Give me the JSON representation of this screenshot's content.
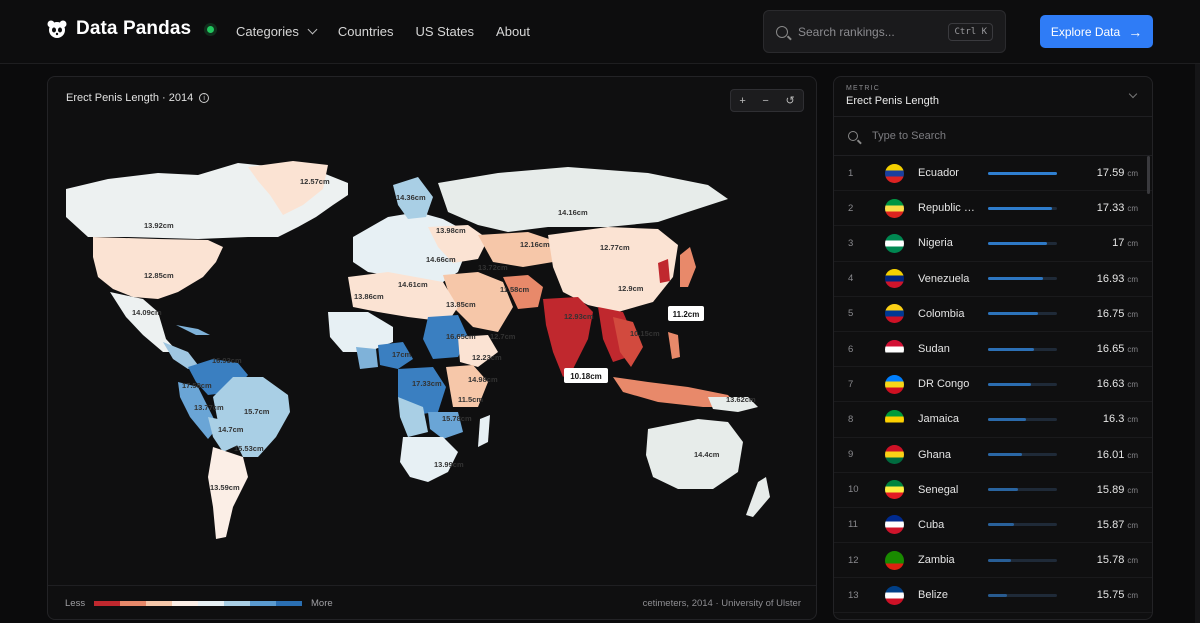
{
  "header": {
    "logo_text": "Data Pandas",
    "nav": [
      {
        "label": "Categories",
        "has_dropdown": true
      },
      {
        "label": "Countries"
      },
      {
        "label": "US States"
      },
      {
        "label": "About"
      }
    ],
    "search_placeholder": "Search rankings...",
    "search_shortcut": "Ctrl K",
    "cta_label": "Explore Data",
    "accent": "#2f7cf6"
  },
  "map": {
    "title": "Erect Penis Length · 2014",
    "zoom_in": "+",
    "zoom_out": "−",
    "reset": "↺",
    "legend_less": "Less",
    "legend_more": "More",
    "legend_colors": [
      "#c0282e",
      "#e8896a",
      "#f6c7a9",
      "#fbeee6",
      "#e7f0f4",
      "#a9cfe5",
      "#5b9bd0",
      "#2a6fb3"
    ],
    "source": "cetimeters, 2014 · University of Ulster",
    "labels": [
      {
        "text": "12.57cm"
      },
      {
        "text": "14.36cm"
      },
      {
        "text": "13.92cm"
      },
      {
        "text": "13.98cm"
      },
      {
        "text": "14.16cm"
      },
      {
        "text": "12.85cm"
      },
      {
        "text": "12.16cm"
      },
      {
        "text": "12.77cm"
      },
      {
        "text": "14.66cm"
      },
      {
        "text": "13.72cm"
      },
      {
        "text": "14.61cm"
      },
      {
        "text": "11.58cm"
      },
      {
        "text": "13.86cm"
      },
      {
        "text": "12.9cm"
      },
      {
        "text": "14.09cm"
      },
      {
        "text": "13.85cm"
      },
      {
        "text": "12.93cm"
      },
      {
        "text": "16.65cm"
      },
      {
        "text": "12.7cm"
      },
      {
        "text": "16.93cm"
      },
      {
        "text": "12.23cm"
      },
      {
        "text": "17cm"
      },
      {
        "text": "17.59cm"
      },
      {
        "text": "17.33cm"
      },
      {
        "text": "14.98cm"
      },
      {
        "text": "13.77cm"
      },
      {
        "text": "15.7cm"
      },
      {
        "text": "11.5cm"
      },
      {
        "text": "14.7cm"
      },
      {
        "text": "15.78cm"
      },
      {
        "text": "15.53cm"
      },
      {
        "text": "13.99cm"
      },
      {
        "text": "14.4cm"
      },
      {
        "text": "13.59cm"
      },
      {
        "text": "10.15cm"
      },
      {
        "text": "13.62cm"
      }
    ],
    "tooltips": [
      "11.2cm",
      "10.18cm"
    ]
  },
  "panel": {
    "metric_label": "METRIC",
    "metric_value": "Erect Penis Length",
    "search_placeholder": "Type to Search",
    "unit": "cm",
    "max_value": 17.59,
    "rows": [
      {
        "rank": "1",
        "country": "Ecuador",
        "value": "17.59",
        "flag": [
          "#f4d000",
          "#1a3f9e",
          "#d22"
        ]
      },
      {
        "rank": "2",
        "country": "Republic of the Congo",
        "value": "17.33",
        "flag": [
          "#009543",
          "#fbde4a",
          "#dc241f"
        ]
      },
      {
        "rank": "3",
        "country": "Nigeria",
        "value": "17",
        "flag": [
          "#008751",
          "#ffffff",
          "#008751"
        ]
      },
      {
        "rank": "4",
        "country": "Venezuela",
        "value": "16.93",
        "flag": [
          "#f4d000",
          "#00247d",
          "#cf142b"
        ]
      },
      {
        "rank": "5",
        "country": "Colombia",
        "value": "16.75",
        "flag": [
          "#fcd116",
          "#003893",
          "#ce1126"
        ]
      },
      {
        "rank": "6",
        "country": "Sudan",
        "value": "16.65",
        "flag": [
          "#d21034",
          "#ffffff",
          "#111111"
        ]
      },
      {
        "rank": "7",
        "country": "DR Congo",
        "value": "16.63",
        "flag": [
          "#007fff",
          "#f7d618",
          "#ce1021"
        ]
      },
      {
        "rank": "8",
        "country": "Jamaica",
        "value": "16.3",
        "flag": [
          "#009b3a",
          "#fed100",
          "#111111"
        ]
      },
      {
        "rank": "9",
        "country": "Ghana",
        "value": "16.01",
        "flag": [
          "#ce1126",
          "#fcd116",
          "#006b3f"
        ]
      },
      {
        "rank": "10",
        "country": "Senegal",
        "value": "15.89",
        "flag": [
          "#00853f",
          "#fdef42",
          "#e31b23"
        ]
      },
      {
        "rank": "11",
        "country": "Cuba",
        "value": "15.87",
        "flag": [
          "#002a8f",
          "#ffffff",
          "#cf142b"
        ]
      },
      {
        "rank": "12",
        "country": "Zambia",
        "value": "15.78",
        "flag": [
          "#198a00",
          "#198a00",
          "#de2010"
        ]
      },
      {
        "rank": "13",
        "country": "Belize",
        "value": "15.75",
        "flag": [
          "#003f87",
          "#ffffff",
          "#ce1126"
        ]
      }
    ]
  }
}
